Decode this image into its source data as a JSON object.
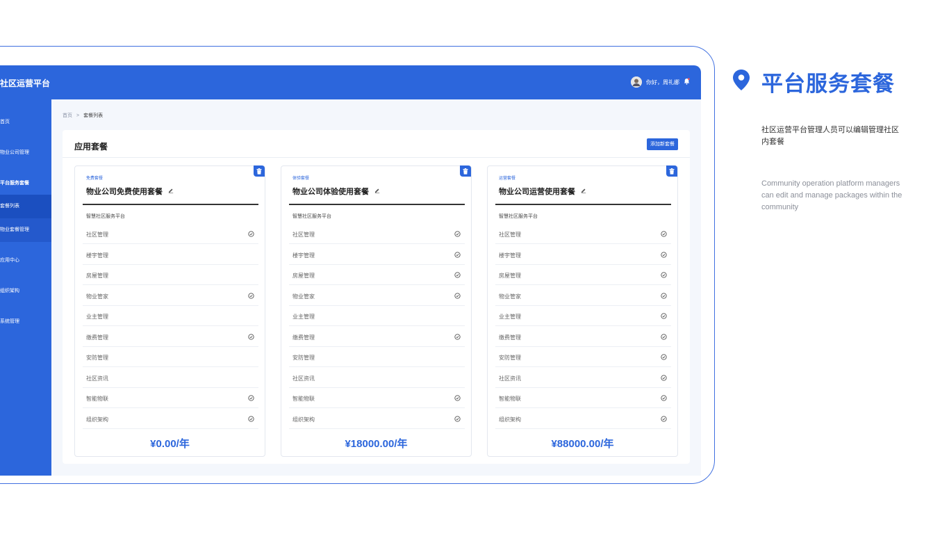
{
  "app": {
    "brand": "社区运营平台",
    "greeting": "你好，周礼娜"
  },
  "sidebar": {
    "items": [
      {
        "label": "首页"
      },
      {
        "label": "物业公司管理"
      },
      {
        "label": "平台服务套餐"
      },
      {
        "label": "套餐列表"
      },
      {
        "label": "物业套餐管理"
      },
      {
        "label": "应用中心"
      },
      {
        "label": "组织架构"
      },
      {
        "label": "系统管理"
      }
    ]
  },
  "breadcrumb": {
    "home": "首页",
    "separator": ">",
    "current": "套餐列表"
  },
  "panel": {
    "title": "应用套餐",
    "add_button": "添加新套餐"
  },
  "cards": [
    {
      "tag": "免费套餐",
      "name": "物业公司免费使用套餐",
      "platform": "智慧社区服务平台",
      "features": [
        {
          "label": "社区管理",
          "checked": true
        },
        {
          "label": "楼宇管理",
          "checked": false
        },
        {
          "label": "房屋管理",
          "checked": false
        },
        {
          "label": "物业管家",
          "checked": true
        },
        {
          "label": "业主管理",
          "checked": false
        },
        {
          "label": "缴费管理",
          "checked": true
        },
        {
          "label": "安防管理",
          "checked": false
        },
        {
          "label": "社区资讯",
          "checked": false
        },
        {
          "label": "智能物联",
          "checked": true
        },
        {
          "label": "组织架构",
          "checked": true
        }
      ],
      "price": "¥0.00/年"
    },
    {
      "tag": "体验套餐",
      "name": "物业公司体验使用套餐",
      "platform": "智慧社区服务平台",
      "features": [
        {
          "label": "社区管理",
          "checked": true
        },
        {
          "label": "楼宇管理",
          "checked": true
        },
        {
          "label": "房屋管理",
          "checked": true
        },
        {
          "label": "物业管家",
          "checked": true
        },
        {
          "label": "业主管理",
          "checked": false
        },
        {
          "label": "缴费管理",
          "checked": true
        },
        {
          "label": "安防管理",
          "checked": false
        },
        {
          "label": "社区资讯",
          "checked": false
        },
        {
          "label": "智能物联",
          "checked": true
        },
        {
          "label": "组织架构",
          "checked": true
        }
      ],
      "price": "¥18000.00/年"
    },
    {
      "tag": "运营套餐",
      "name": "物业公司运营使用套餐",
      "platform": "智慧社区服务平台",
      "features": [
        {
          "label": "社区管理",
          "checked": true
        },
        {
          "label": "楼宇管理",
          "checked": true
        },
        {
          "label": "房屋管理",
          "checked": true
        },
        {
          "label": "物业管家",
          "checked": true
        },
        {
          "label": "业主管理",
          "checked": true
        },
        {
          "label": "缴费管理",
          "checked": true
        },
        {
          "label": "安防管理",
          "checked": true
        },
        {
          "label": "社区资讯",
          "checked": true
        },
        {
          "label": "智能物联",
          "checked": true
        },
        {
          "label": "组织架构",
          "checked": true
        }
      ],
      "price": "¥88000.00/年"
    }
  ],
  "aside": {
    "title": "平台服务套餐",
    "desc_cn": "社区运营平台管理人员可以编辑管理社区内套餐",
    "desc_en": "Community operation platform managers can edit and manage packages within the community"
  },
  "colors": {
    "accent": "#2c66dc",
    "sidebar_active": "#1b4fc0"
  },
  "icons": {
    "location": "map-pin-icon",
    "bell": "bell-icon",
    "trash": "trash-icon",
    "edit": "pencil-icon",
    "check": "check-circle-icon"
  }
}
